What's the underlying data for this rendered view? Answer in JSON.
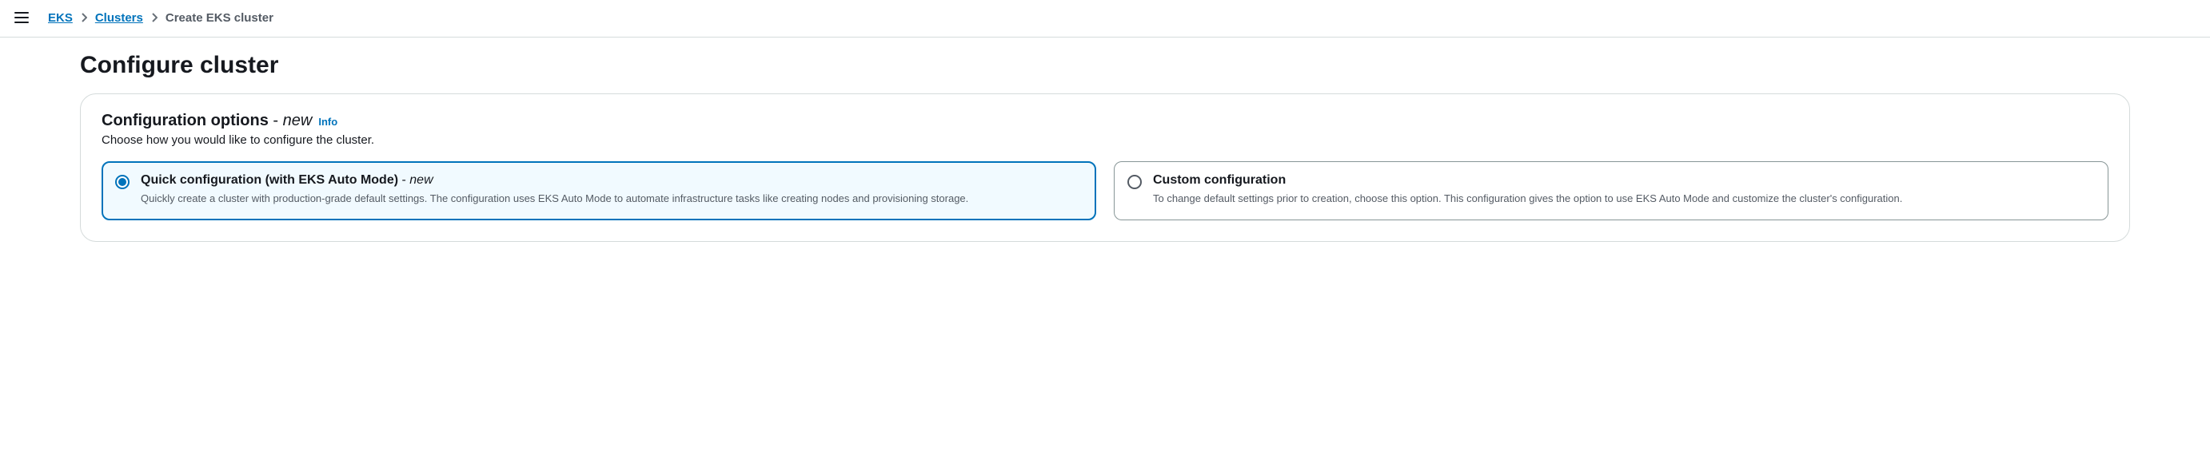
{
  "breadcrumb": {
    "items": [
      {
        "label": "EKS"
      },
      {
        "label": "Clusters"
      }
    ],
    "current": "Create EKS cluster"
  },
  "page": {
    "title": "Configure cluster"
  },
  "panel": {
    "title_prefix": "Configuration options",
    "dash": " - ",
    "title_new": "new",
    "info": "Info",
    "subtitle": "Choose how you would like to configure the cluster."
  },
  "options": {
    "quick": {
      "title_prefix": "Quick configuration (with EKS Auto Mode)",
      "dash": " - ",
      "title_new": "new",
      "description": "Quickly create a cluster with production-grade default settings. The configuration uses EKS Auto Mode to automate infrastructure tasks like creating nodes and provisioning storage."
    },
    "custom": {
      "title": "Custom configuration",
      "description": "To change default settings prior to creation, choose this option. This configuration gives the option to use EKS Auto Mode and customize the cluster's configuration."
    }
  }
}
